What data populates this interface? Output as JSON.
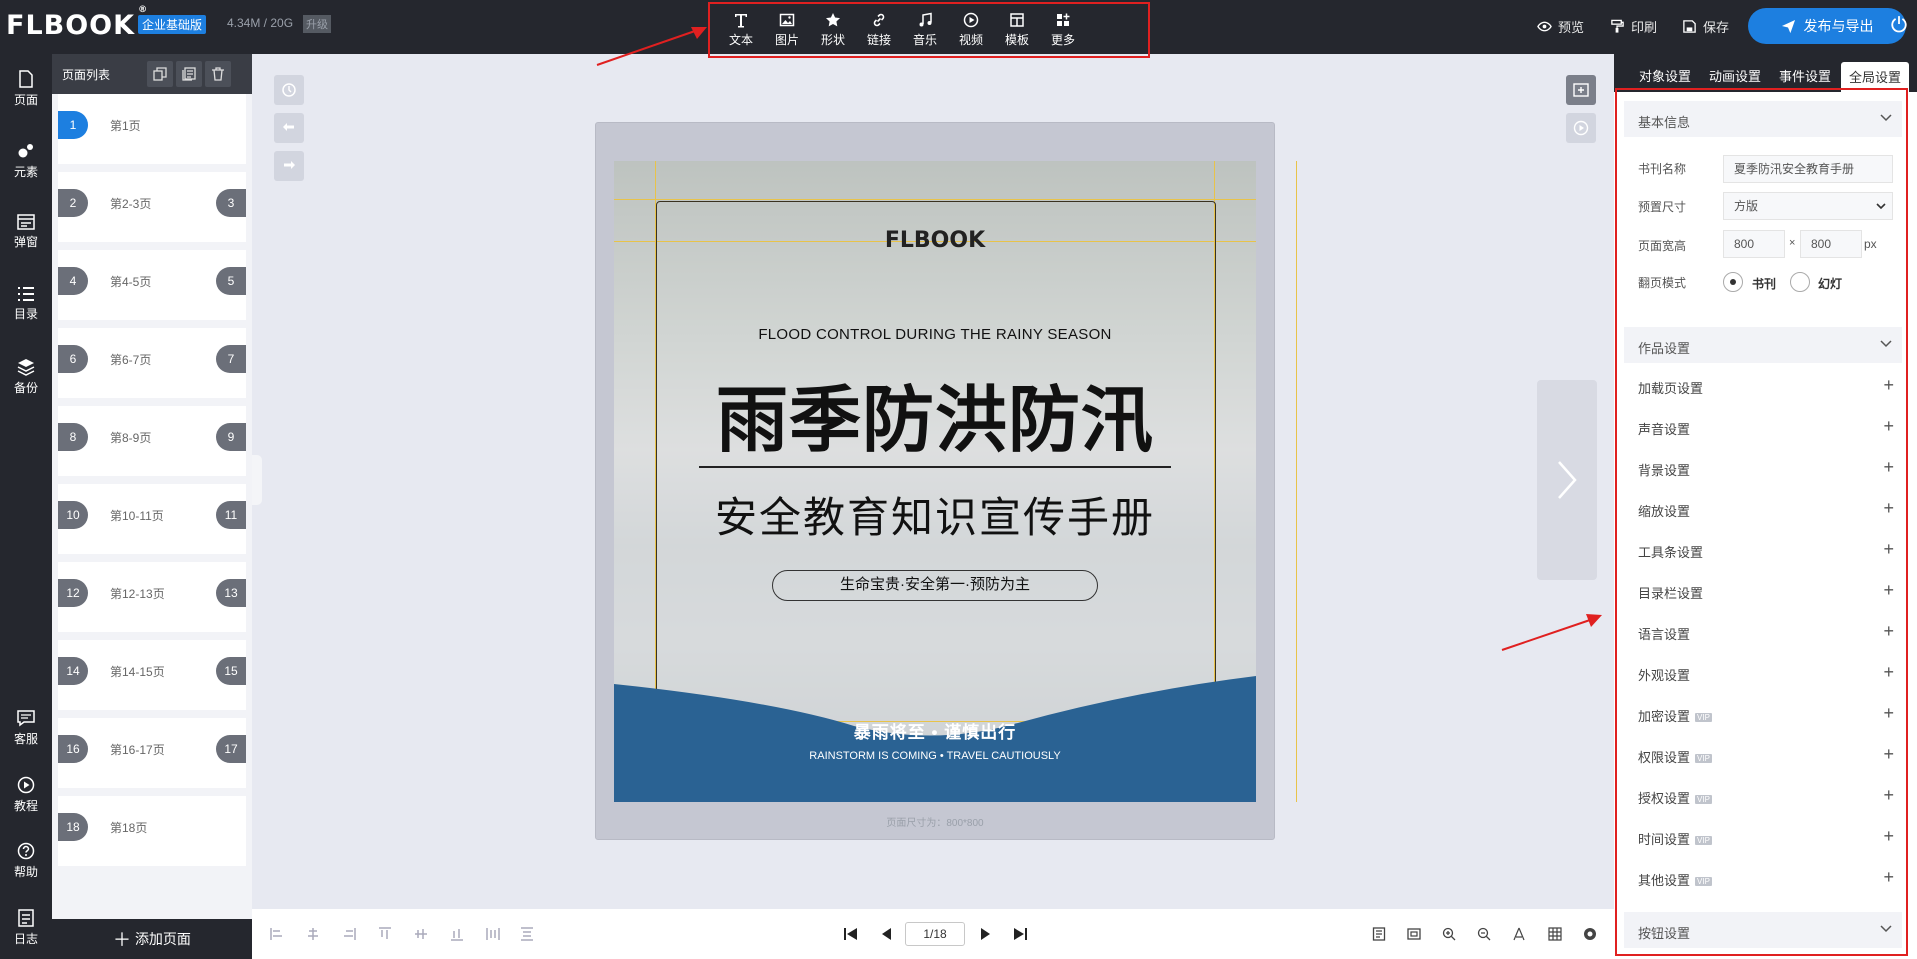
{
  "header": {
    "logo": "FLBOOK",
    "edition_badge": "企业基础版",
    "storage": "4.34M / 20G",
    "upgrade": "升级",
    "tools": [
      "文本",
      "图片",
      "形状",
      "链接",
      "音乐",
      "视频",
      "模板",
      "更多"
    ],
    "preview": "预览",
    "print": "印刷",
    "save": "保存",
    "publish": "发布与导出"
  },
  "leftnav": {
    "items": [
      "页面",
      "元素",
      "弹窗",
      "目录",
      "备份",
      "客服",
      "教程",
      "帮助",
      "日志"
    ]
  },
  "pages_panel": {
    "title": "页面列表",
    "add_page": "添加页面",
    "pages": [
      {
        "left": "1",
        "label": "第1页",
        "right": ""
      },
      {
        "left": "2",
        "label": "第2-3页",
        "right": "3"
      },
      {
        "left": "4",
        "label": "第4-5页",
        "right": "5"
      },
      {
        "left": "6",
        "label": "第6-7页",
        "right": "7"
      },
      {
        "left": "8",
        "label": "第8-9页",
        "right": "9"
      },
      {
        "left": "10",
        "label": "第10-11页",
        "right": "11"
      },
      {
        "left": "12",
        "label": "第12-13页",
        "right": "13"
      },
      {
        "left": "14",
        "label": "第14-15页",
        "right": "15"
      },
      {
        "left": "16",
        "label": "第16-17页",
        "right": "17"
      },
      {
        "left": "18",
        "label": "第18页",
        "right": ""
      }
    ]
  },
  "canvas": {
    "logo": "FLBOOK",
    "en_title": "FLOOD CONTROL DURING THE RAINY SEASON",
    "title": "雨季防洪防汛",
    "subtitle": "安全教育知识宣传手册",
    "pill": "生命宝贵·安全第一·预防为主",
    "bottom_cn": "暴雨将至 • 谨慎出行",
    "bottom_en": "RAINSTORM IS COMING  •  TRAVEL CAUTIOUSLY",
    "page_size": "页面尺寸为：800*800"
  },
  "pager": {
    "current": "1/18"
  },
  "right_panel": {
    "tabs": [
      "对象设置",
      "动画设置",
      "事件设置",
      "全局设置"
    ],
    "basic_info": {
      "title": "基本信息",
      "book_name_label": "书刊名称",
      "book_name": "夏季防汛安全教育手册",
      "preset_label": "预置尺寸",
      "preset": "方版",
      "size_label": "页面宽高",
      "width": "800",
      "times": "×",
      "height": "800",
      "unit": "px",
      "flip_label": "翻页模式",
      "flip_book": "书刊",
      "flip_slide": "幻灯"
    },
    "works_title": "作品设置",
    "items": [
      {
        "label": "加载页设置",
        "vip": false
      },
      {
        "label": "声音设置",
        "vip": false
      },
      {
        "label": "背景设置",
        "vip": false
      },
      {
        "label": "缩放设置",
        "vip": false
      },
      {
        "label": "工具条设置",
        "vip": false
      },
      {
        "label": "目录栏设置",
        "vip": false
      },
      {
        "label": "语言设置",
        "vip": false
      },
      {
        "label": "外观设置",
        "vip": false
      },
      {
        "label": "加密设置",
        "vip": true
      },
      {
        "label": "权限设置",
        "vip": true
      },
      {
        "label": "授权设置",
        "vip": true
      },
      {
        "label": "时间设置",
        "vip": true
      },
      {
        "label": "其他设置",
        "vip": true
      }
    ],
    "vip_tag": "VIP",
    "button_settings": "按钮设置"
  },
  "colors": {
    "accent": "#1d7fe0",
    "dark": "#25272e",
    "highlight": "#e02020",
    "wave": "#2a6293"
  }
}
